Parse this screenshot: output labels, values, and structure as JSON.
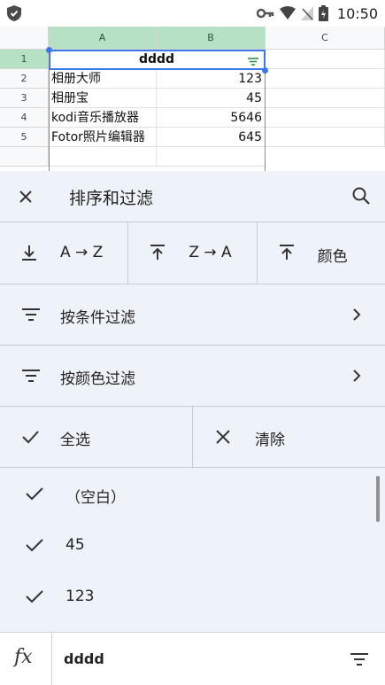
{
  "status_bar": {
    "time": "10:50"
  },
  "sheet": {
    "columns": [
      "A",
      "B",
      "C"
    ],
    "rows": [
      {
        "num": "1",
        "a": "dddd",
        "b": ""
      },
      {
        "num": "2",
        "a": "相册大师",
        "b": "123"
      },
      {
        "num": "3",
        "a": "相册宝",
        "b": "45"
      },
      {
        "num": "4",
        "a": "kodi音乐播放器",
        "b": "5646"
      },
      {
        "num": "5",
        "a": "Fotor照片编辑器",
        "b": "645"
      }
    ]
  },
  "panel": {
    "title": "排序和过滤",
    "sort": {
      "asc": "A → Z",
      "desc": "Z → A",
      "color": "颜色"
    },
    "filter_by_condition": "按条件过滤",
    "filter_by_color": "按颜色过滤",
    "select_all": "全选",
    "clear": "清除",
    "values": [
      "（空白）",
      "45",
      "123"
    ]
  },
  "formula_bar": {
    "fx": "fx",
    "value": "dddd"
  },
  "colors": {
    "accent_green": "#1e8e3e",
    "header_green": "#b7e1c4",
    "selection_blue": "#3b78e7"
  }
}
